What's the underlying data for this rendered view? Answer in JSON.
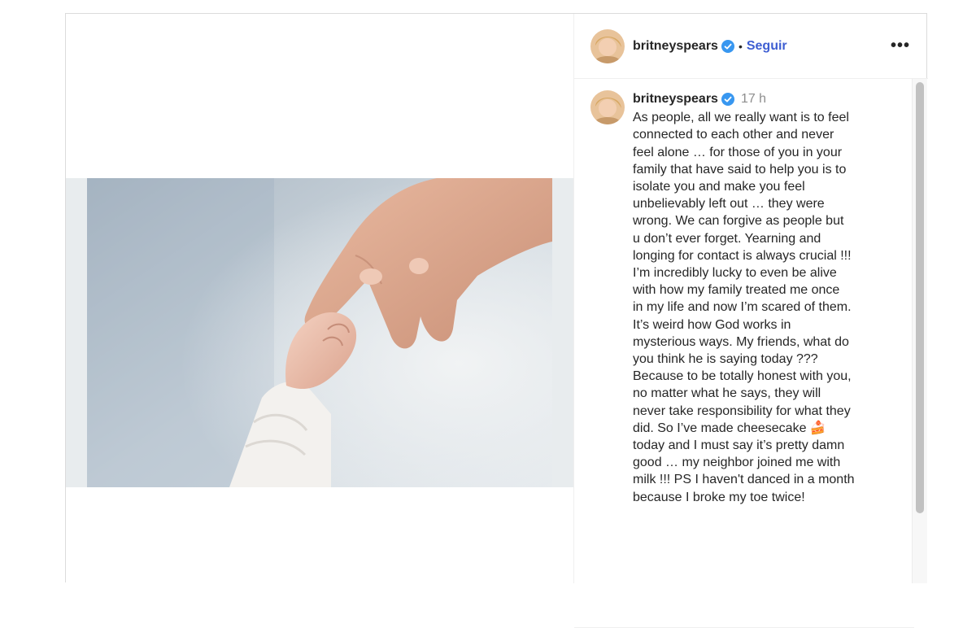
{
  "post": {
    "image_alt": "adult hand holding baby's hand",
    "user": {
      "username": "britneyspears",
      "verified": true,
      "verified_icon": "verified-badge-icon",
      "follow_label": "Seguir",
      "separator": "•",
      "more_label": "•••"
    },
    "caption": {
      "username": "britneyspears",
      "time": "17 h",
      "text": "As people, all we really want is to feel\nconnected to each other and never\nfeel alone … for those of you in your\nfamily that have said to help you is to\nisolate you and make you feel\nunbelievably left out … they were\nwrong. We can forgive as people but\nu don’t ever forget. Yearning and\nlonging for contact is always crucial !!!\nI’m incredibly lucky to even be alive\nwith how my family treated me once\nin my life and now I’m scared of them.\nIt’s weird how God works in\nmysterious ways. My friends, what do\nyou think he is saying today ???\nBecause to be totally honest with you,\nno matter what he says, they will\nnever take responsibility for what they\ndid. So I’ve made cheesecake 🍰\ntoday and I must say it’s pretty damn\ngood … my neighbor joined me with\nmilk !!! PS I haven't danced in a month\nbecause I broke my toe twice!"
    }
  },
  "colors": {
    "follow": "#3e5ed2",
    "verified": "#3897f0",
    "time": "#8e8e8e"
  }
}
